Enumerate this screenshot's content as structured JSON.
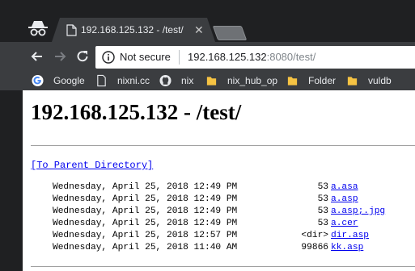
{
  "tab": {
    "title": "192.168.125.132 - /test/",
    "close_glyph": "✕"
  },
  "toolbar": {
    "back_icon": "back-arrow-icon",
    "forward_icon": "forward-arrow-icon",
    "reload_icon": "reload-icon",
    "security_label": "Not secure",
    "url_host": "192.168.125.132",
    "url_rest": ":8080/test/"
  },
  "bookmarks": [
    {
      "label": "Google",
      "icon": "google-icon"
    },
    {
      "label": "nixni.cc",
      "icon": "page-icon"
    },
    {
      "label": "nix",
      "icon": "github-icon"
    },
    {
      "label": "nix_hub_op",
      "icon": "folder-icon"
    },
    {
      "label": "Folder",
      "icon": "folder-icon"
    },
    {
      "label": "vuldb",
      "icon": "folder-icon"
    }
  ],
  "page": {
    "title": "192.168.125.132 - /test/",
    "parent_link": "[To Parent Directory]",
    "entries": [
      {
        "date": "Wednesday, April 25, 2018 12:49 PM",
        "size": "53",
        "name": "a.asa"
      },
      {
        "date": "Wednesday, April 25, 2018 12:49 PM",
        "size": "53",
        "name": "a.asp"
      },
      {
        "date": "Wednesday, April 25, 2018 12:49 PM",
        "size": "53",
        "name": "a.asp;.jpg"
      },
      {
        "date": "Wednesday, April 25, 2018 12:49 PM",
        "size": "53",
        "name": "a.cer"
      },
      {
        "date": "Wednesday, April 25, 2018 12:57 PM",
        "size": "<dir>",
        "name": "dir.asp"
      },
      {
        "date": "Wednesday, April 25, 2018 11:40 AM",
        "size": "99866",
        "name": "kk.asp"
      }
    ]
  },
  "colors": {
    "chrome_dark": "#1f2022",
    "toolbar": "#3b3d40",
    "link": "#0000ee",
    "folder": "#f6c343"
  }
}
